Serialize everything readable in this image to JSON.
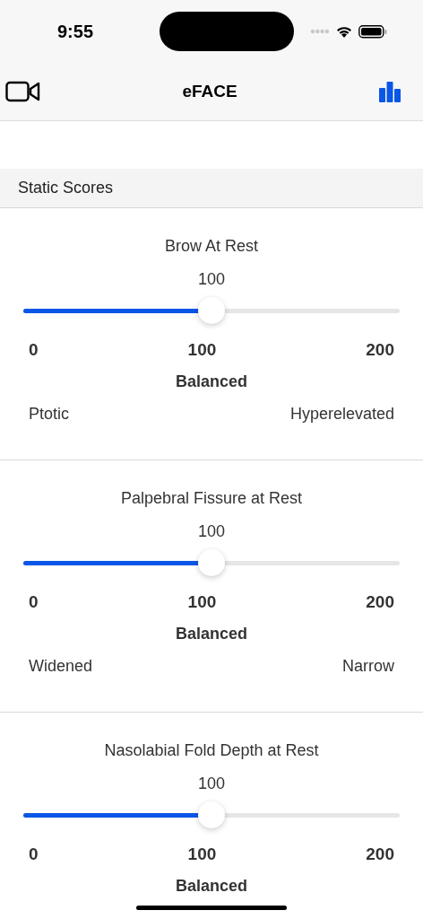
{
  "status_bar": {
    "time": "9:55"
  },
  "nav": {
    "title": "eFACE"
  },
  "section": {
    "title": "Static Scores"
  },
  "items": [
    {
      "title": "Brow At Rest",
      "value": "100",
      "level": 0.5,
      "ticks": [
        "0",
        "100",
        "200"
      ],
      "state": "Balanced",
      "low": "Ptotic",
      "high": "Hyperelevated"
    },
    {
      "title": "Palpebral Fissure at Rest",
      "value": "100",
      "level": 0.5,
      "ticks": [
        "0",
        "100",
        "200"
      ],
      "state": "Balanced",
      "low": "Widened",
      "high": "Narrow"
    },
    {
      "title": "Nasolabial Fold Depth at Rest",
      "value": "100",
      "level": 0.5,
      "ticks": [
        "0",
        "100",
        "200"
      ],
      "state": "Balanced"
    }
  ]
}
